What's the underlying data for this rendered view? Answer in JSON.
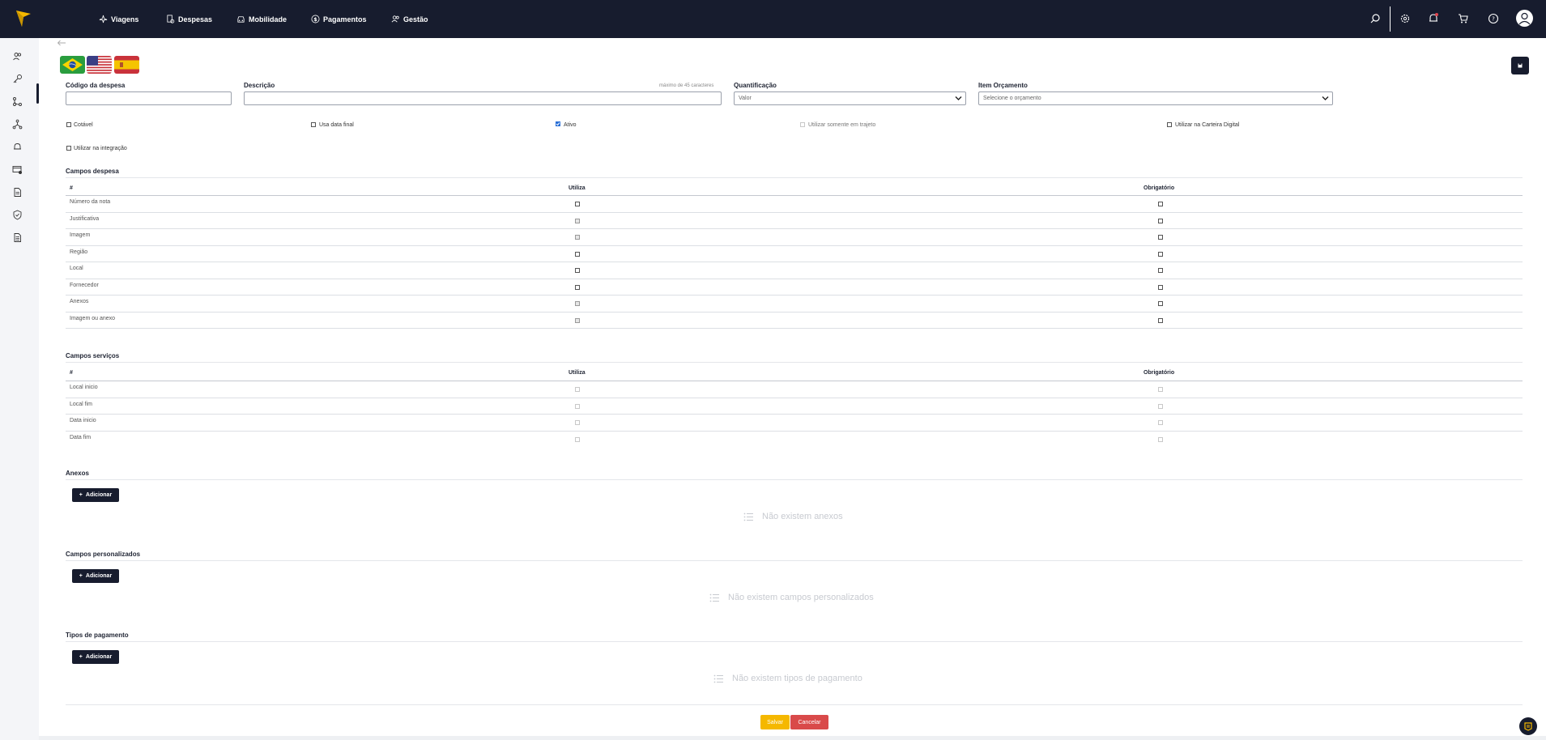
{
  "nav": {
    "items": [
      {
        "label": "Viagens",
        "icon": "plane-icon"
      },
      {
        "label": "Despesas",
        "icon": "receipt-icon"
      },
      {
        "label": "Mobilidade",
        "icon": "car-icon"
      },
      {
        "label": "Pagamentos",
        "icon": "dollar-icon"
      },
      {
        "label": "Gestão",
        "icon": "users-icon"
      }
    ],
    "right_icons": [
      "search-icon",
      "gear-icon",
      "bell-icon",
      "cart-icon",
      "help-icon",
      "avatar-icon"
    ],
    "notification_dot_color": "#e0454f"
  },
  "sidebar": {
    "icons": [
      "users-icon",
      "key-icon",
      "git-branch-icon",
      "fork-icon",
      "bell-icon",
      "card-settings-icon",
      "document-icon",
      "shield-icon",
      "file-list-icon"
    ]
  },
  "flags": [
    "Brazil",
    "USA",
    "Spain"
  ],
  "form": {
    "codigo_label": "Código da despesa",
    "codigo_value": "",
    "descricao_label": "Descrição",
    "descricao_hint": "máximo de 45 caracteres",
    "descricao_value": "",
    "quantificacao_label": "Quantificação",
    "quantificacao_value": "Valor",
    "orcamento_label": "Item Orçamento",
    "orcamento_placeholder": "Selecione o orçamento"
  },
  "options": [
    {
      "label": "Cotável",
      "checked": false,
      "disabled": false
    },
    {
      "label": "Usa data final",
      "checked": false,
      "disabled": false
    },
    {
      "label": "Ativo",
      "checked": true,
      "disabled": false
    },
    {
      "label": "Utilizar somente em trajeto",
      "checked": false,
      "disabled": true
    },
    {
      "label": "Utilizar na Carteira Digital",
      "checked": false,
      "disabled": false
    },
    {
      "label": "Utilizar na integração",
      "checked": false,
      "disabled": false
    }
  ],
  "campos_despesa": {
    "title": "Campos despesa",
    "headers": [
      "#",
      "Utiliza",
      "Obrigatório"
    ],
    "rows": [
      {
        "name": "Número da nota",
        "utiliza": "normal",
        "obrigatorio": "normal"
      },
      {
        "name": "Justificativa",
        "utiliza": "dim",
        "obrigatorio": "normal"
      },
      {
        "name": "Imagem",
        "utiliza": "dim",
        "obrigatorio": "normal"
      },
      {
        "name": "Região",
        "utiliza": "normal",
        "obrigatorio": "normal"
      },
      {
        "name": "Local",
        "utiliza": "normal",
        "obrigatorio": "normal"
      },
      {
        "name": "Fornecedor",
        "utiliza": "normal",
        "obrigatorio": "normal"
      },
      {
        "name": "Anexos",
        "utiliza": "dim",
        "obrigatorio": "normal"
      },
      {
        "name": "Imagem ou anexo",
        "utiliza": "dim",
        "obrigatorio": "normal"
      }
    ]
  },
  "campos_servicos": {
    "title": "Campos serviços",
    "headers": [
      "#",
      "Utiliza",
      "Obrigatório"
    ],
    "rows": [
      {
        "name": "Local inicio"
      },
      {
        "name": "Local fim"
      },
      {
        "name": "Data inicio"
      },
      {
        "name": "Data fim"
      }
    ]
  },
  "anexos": {
    "title": "Anexos",
    "add_label": "Adicionar",
    "empty_text": "Não existem anexos"
  },
  "personalizados": {
    "title": "Campos personalizados",
    "add_label": "Adicionar",
    "empty_text": "Não existem campos personalizados"
  },
  "pagamento": {
    "title": "Tipos de pagamento",
    "add_label": "Adicionar",
    "empty_text": "Não existem tipos de pagamento"
  },
  "actions": {
    "save_label": "Salvar",
    "cancel_label": "Cancelar"
  },
  "colors": {
    "navy": "#171c2e",
    "yellow": "#f5b800",
    "red": "#d94a4a",
    "check_blue": "#2a6fd6"
  }
}
